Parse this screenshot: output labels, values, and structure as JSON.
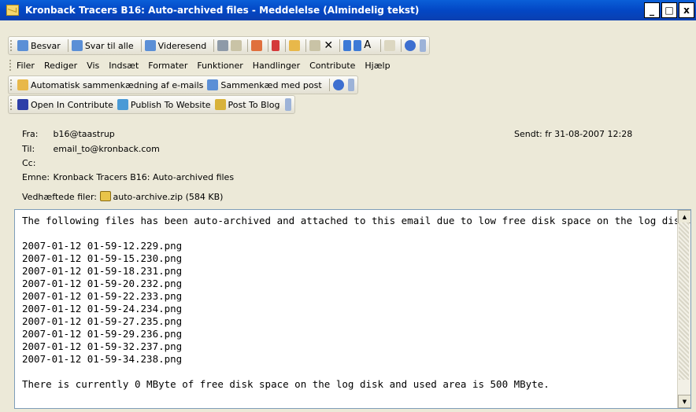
{
  "window": {
    "title": "Kronback Tracers B16: Auto-archived files - Meddelelse (Almindelig tekst)",
    "minimize": "_",
    "maximize": "□",
    "close": "x"
  },
  "toolbar1": {
    "reply": "Besvar",
    "reply_all": "Svar til alle",
    "forward": "Videresend"
  },
  "menubar": {
    "items": [
      "Filer",
      "Rediger",
      "Vis",
      "Indsæt",
      "Formater",
      "Funktioner",
      "Handlinger",
      "Contribute",
      "Hjælp"
    ]
  },
  "toolbar2": {
    "auto_link": "Automatisk sammenkædning af e-mails",
    "link_post": "Sammenkæd med post"
  },
  "toolbar3": {
    "open_in_contribute": "Open In Contribute",
    "publish": "Publish To Website",
    "post_blog": "Post To Blog"
  },
  "header": {
    "from_label": "Fra:",
    "from": "b16@taastrup",
    "sent_label": "Sendt:",
    "sent": "fr 31-08-2007 12:28",
    "to_label": "Til:",
    "to": "email_to@kronback.com",
    "cc_label": "Cc:",
    "subject_label": "Emne:",
    "subject": "Kronback Tracers B16: Auto-archived files",
    "attach_label": "Vedhæftede filer:",
    "attachment": "auto-archive.zip (584 KB)"
  },
  "body": {
    "text": "The following files has been auto-archived and attached to this email due to low free disk space on the log disk:\n\n2007-01-12 01-59-12.229.png\n2007-01-12 01-59-15.230.png\n2007-01-12 01-59-18.231.png\n2007-01-12 01-59-20.232.png\n2007-01-12 01-59-22.233.png\n2007-01-12 01-59-24.234.png\n2007-01-12 01-59-27.235.png\n2007-01-12 01-59-29.236.png\n2007-01-12 01-59-32.237.png\n2007-01-12 01-59-34.238.png\n\nThere is currently 0 MByte of free disk space on the log disk and used area is 500 MByte."
  },
  "icons": [
    "mail-icon",
    "reply-icon",
    "reply-all-icon",
    "forward-icon",
    "print-icon",
    "copy-icon",
    "flag-icon",
    "delete-icon",
    "help-icon",
    "attachment-icon"
  ],
  "colors": {
    "titlebar": "#0a5fd8",
    "toolbar": "#ece9d8",
    "body_bg": "#ffffff"
  }
}
